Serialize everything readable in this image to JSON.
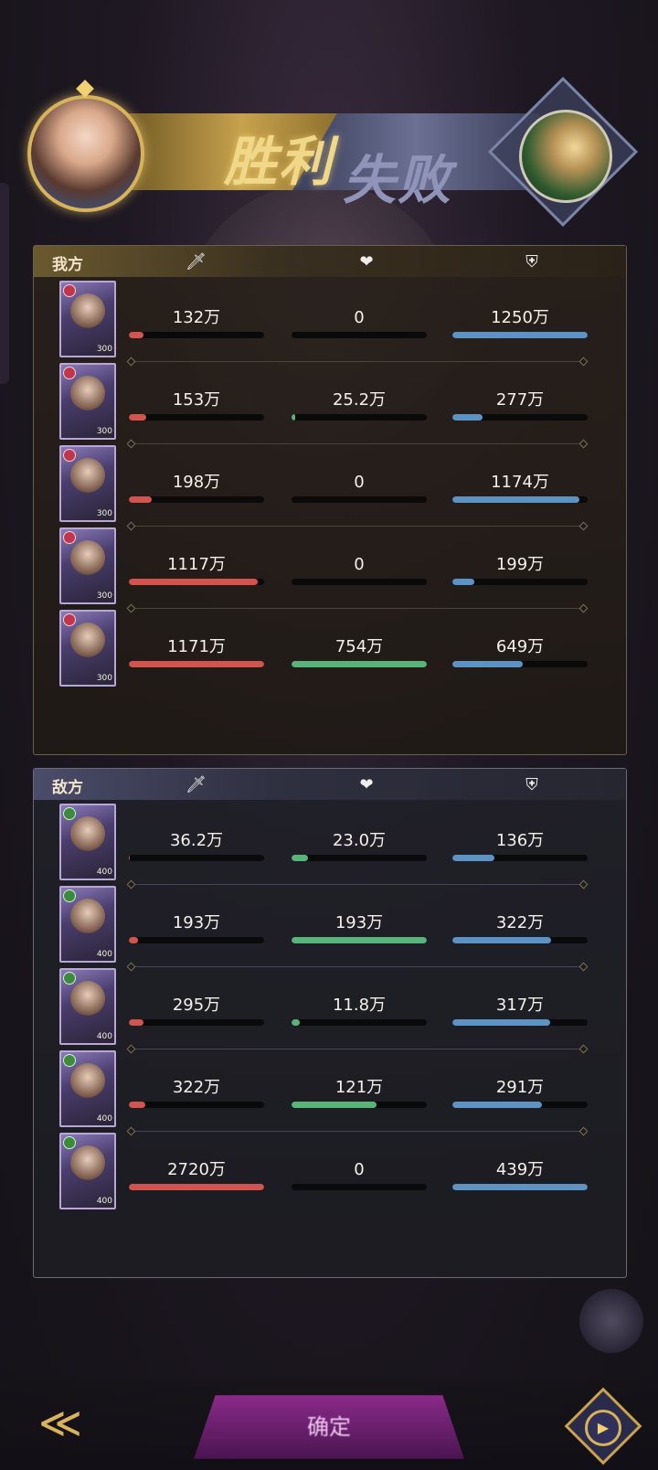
{
  "header": {
    "win_label": "胜利",
    "lose_label": "失败",
    "colors": {
      "win": "#f0d88a",
      "lose": "#8f94b8"
    }
  },
  "columns": {
    "damage_icon": "sword-icon",
    "heal_icon": "heart-icon",
    "tank_icon": "shield-icon"
  },
  "my_team": {
    "label": "我方",
    "rows": [
      {
        "level": "300",
        "damage": "132万",
        "damage_pct": 11,
        "heal": "0",
        "heal_pct": 0,
        "tank": "1250万",
        "tank_pct": 100
      },
      {
        "level": "300",
        "damage": "153万",
        "damage_pct": 13,
        "heal": "25.2万",
        "heal_pct": 3,
        "tank": "277万",
        "tank_pct": 22
      },
      {
        "level": "300",
        "damage": "198万",
        "damage_pct": 17,
        "heal": "0",
        "heal_pct": 0,
        "tank": "1174万",
        "tank_pct": 94
      },
      {
        "level": "300",
        "damage": "1117万",
        "damage_pct": 95,
        "heal": "0",
        "heal_pct": 0,
        "tank": "199万",
        "tank_pct": 16
      },
      {
        "level": "300",
        "damage": "1171万",
        "damage_pct": 100,
        "heal": "754万",
        "heal_pct": 100,
        "tank": "649万",
        "tank_pct": 52
      }
    ]
  },
  "enemy_team": {
    "label": "敌方",
    "rows": [
      {
        "level": "400",
        "damage": "36.2万",
        "damage_pct": 1,
        "heal": "23.0万",
        "heal_pct": 12,
        "tank": "136万",
        "tank_pct": 31
      },
      {
        "level": "400",
        "damage": "193万",
        "damage_pct": 7,
        "heal": "193万",
        "heal_pct": 100,
        "tank": "322万",
        "tank_pct": 73
      },
      {
        "level": "400",
        "damage": "295万",
        "damage_pct": 11,
        "heal": "11.8万",
        "heal_pct": 6,
        "tank": "317万",
        "tank_pct": 72
      },
      {
        "level": "400",
        "damage": "322万",
        "damage_pct": 12,
        "heal": "121万",
        "heal_pct": 63,
        "tank": "291万",
        "tank_pct": 66
      },
      {
        "level": "400",
        "damage": "2720万",
        "damage_pct": 100,
        "heal": "0",
        "heal_pct": 0,
        "tank": "439万",
        "tank_pct": 100
      }
    ]
  },
  "footer": {
    "back_icon": "back-arrow-icon",
    "confirm_label": "确定",
    "replay_icon": "replay-icon"
  }
}
